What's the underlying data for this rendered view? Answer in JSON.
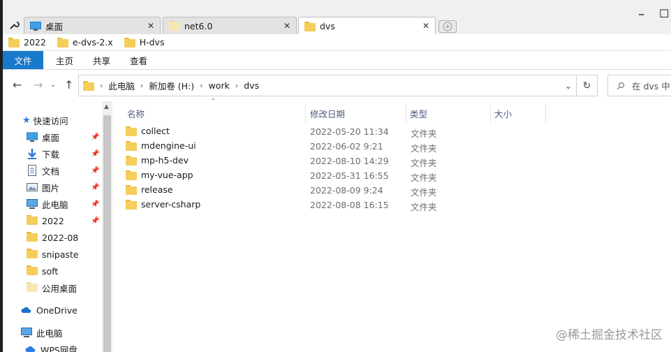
{
  "tabs": [
    {
      "label": "桌面",
      "icon": "desktop-icon"
    },
    {
      "label": "net6.0",
      "icon": "folder-icon"
    },
    {
      "label": "dvs",
      "icon": "folder-icon"
    }
  ],
  "bookmarks": [
    "2022",
    "e-dvs-2.x",
    "H-dvs"
  ],
  "ribbon": {
    "file": "文件",
    "home": "主页",
    "share": "共享",
    "view": "查看"
  },
  "address": {
    "path": [
      "此电脑",
      "新加卷 (H:)",
      "work",
      "dvs"
    ]
  },
  "search": {
    "placeholder": "在 dvs 中"
  },
  "nav": {
    "quick_access": "快速访问",
    "items": [
      {
        "label": "桌面",
        "icon": "desktop-icon",
        "pinned": true
      },
      {
        "label": "下载",
        "icon": "download-icon",
        "pinned": true
      },
      {
        "label": "文档",
        "icon": "document-icon",
        "pinned": true
      },
      {
        "label": "图片",
        "icon": "picture-icon",
        "pinned": true
      },
      {
        "label": "此电脑",
        "icon": "computer-icon",
        "pinned": true
      },
      {
        "label": "2022",
        "icon": "folder-icon",
        "pinned": true
      },
      {
        "label": "2022-08",
        "icon": "folder-icon",
        "pinned": false
      },
      {
        "label": "snipaste",
        "icon": "folder-icon",
        "pinned": false
      },
      {
        "label": "soft",
        "icon": "folder-icon",
        "pinned": false
      },
      {
        "label": "公用桌面",
        "icon": "folder-icon",
        "pinned": false
      }
    ],
    "onedrive": "OneDrive",
    "this_pc": "此电脑",
    "wps": "WPS网盘"
  },
  "columns": {
    "name": "名称",
    "date": "修改日期",
    "type": "类型",
    "size": "大小"
  },
  "files": [
    {
      "name": "collect",
      "date": "2022-05-20 11:34",
      "type": "文件夹"
    },
    {
      "name": "mdengine-ui",
      "date": "2022-06-02 9:21",
      "type": "文件夹"
    },
    {
      "name": "mp-h5-dev",
      "date": "2022-08-10 14:29",
      "type": "文件夹"
    },
    {
      "name": "my-vue-app",
      "date": "2022-05-31 16:55",
      "type": "文件夹"
    },
    {
      "name": "release",
      "date": "2022-08-09 9:24",
      "type": "文件夹"
    },
    {
      "name": "server-csharp",
      "date": "2022-08-08 16:15",
      "type": "文件夹"
    }
  ],
  "watermark": "@稀土掘金技术社区",
  "colors": {
    "accent": "#1979ca",
    "folder": "#f5cd5b",
    "header_text": "#4d5b7c"
  }
}
